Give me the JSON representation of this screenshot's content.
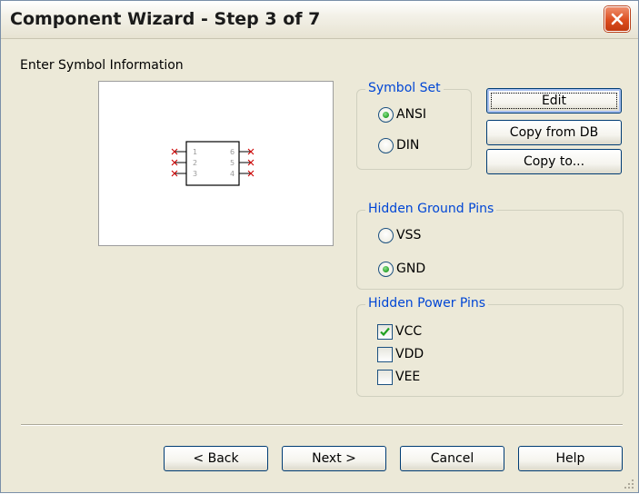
{
  "window": {
    "title": "Component Wizard - Step 3 of 7"
  },
  "section_label": "Enter Symbol Information",
  "symbol_preview": {
    "left_pins": [
      "1",
      "2",
      "3"
    ],
    "right_pins": [
      "6",
      "5",
      "4"
    ]
  },
  "symbol_set": {
    "legend": "Symbol Set",
    "options": [
      {
        "label": "ANSI",
        "selected": true
      },
      {
        "label": "DIN",
        "selected": false
      }
    ]
  },
  "side_buttons": {
    "edit": "Edit",
    "copy_from_db": "Copy from DB",
    "copy_to": "Copy to..."
  },
  "hidden_ground_pins": {
    "legend": "Hidden Ground Pins",
    "options": [
      {
        "label": "VSS",
        "selected": false
      },
      {
        "label": "GND",
        "selected": true
      }
    ]
  },
  "hidden_power_pins": {
    "legend": "Hidden Power Pins",
    "items": [
      {
        "label": "VCC",
        "checked": true
      },
      {
        "label": "VDD",
        "checked": false
      },
      {
        "label": "VEE",
        "checked": false
      }
    ]
  },
  "footer_buttons": {
    "back": "< Back",
    "next": "Next >",
    "cancel": "Cancel",
    "help": "Help"
  },
  "colors": {
    "legend_text": "#0046d5",
    "dialog_background": "#ece9d8",
    "close_button": "#dc4d1f",
    "pin_marker": "#cc0000"
  }
}
